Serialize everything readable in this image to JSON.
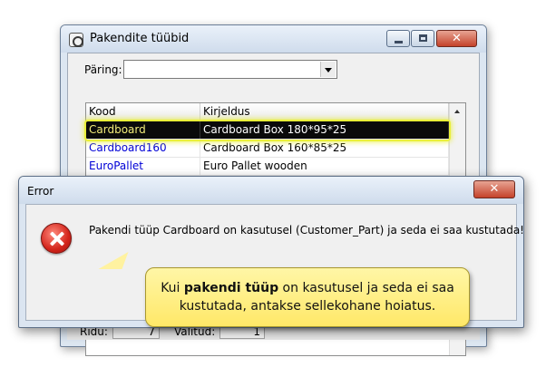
{
  "main_window": {
    "title": "Pakendite tüübid",
    "query_label": "Päring:",
    "query_value": "",
    "columns": [
      "Kood",
      "Kirjeldus"
    ],
    "rows": [
      {
        "code": "Cardboard",
        "description": "Cardboard Box 180*95*25",
        "selected": true
      },
      {
        "code": "Cardboard160",
        "description": "Cardboard Box 160*85*25",
        "selected": false
      },
      {
        "code": "EuroPallet",
        "description": "Euro Pallet wooden",
        "selected": false
      }
    ],
    "status": {
      "rows_label": "Ridu:",
      "rows_value": "7",
      "selected_label": "Valitud:",
      "selected_value": "1"
    }
  },
  "error_dialog": {
    "title": "Error",
    "message": "Pakendi tüüp Cardboard on kasutusel (Customer_Part) ja seda ei saa kustutada!",
    "icon": "error-icon",
    "close_glyph": "✕"
  },
  "callout": {
    "prefix": "Kui ",
    "bold": "pakendi tüüp",
    "suffix_line1": " on kasutusel ja seda ei saa",
    "line2": "kustutada, antakse sellekohane hoiatus."
  },
  "colors": {
    "accent_highlight": "#e9ef3a",
    "link_blue": "#0000d6",
    "callout_bg": "#ffe868"
  }
}
